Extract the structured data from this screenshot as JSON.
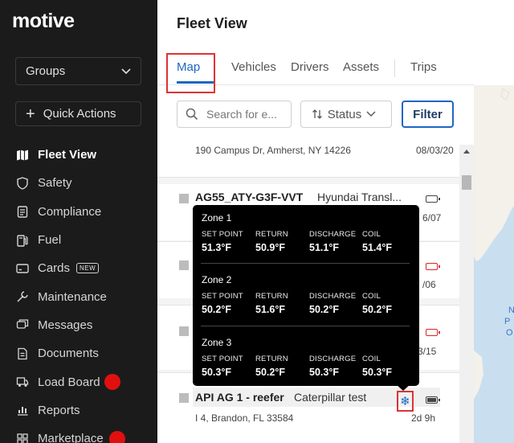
{
  "sidebar": {
    "logo": "motive",
    "groups_label": "Groups",
    "quick_actions_label": "Quick Actions",
    "nav": [
      {
        "label": "Fleet View",
        "icon": "map-icon",
        "active": true
      },
      {
        "label": "Safety",
        "icon": "shield-icon"
      },
      {
        "label": "Compliance",
        "icon": "clipboard-icon"
      },
      {
        "label": "Fuel",
        "icon": "fuel-pump-icon"
      },
      {
        "label": "Cards",
        "icon": "card-icon",
        "badge": "NEW"
      },
      {
        "label": "Maintenance",
        "icon": "wrench-icon"
      },
      {
        "label": "Messages",
        "icon": "chat-icon"
      },
      {
        "label": "Documents",
        "icon": "document-icon"
      },
      {
        "label": "Load Board",
        "icon": "truck-icon",
        "dot": true
      },
      {
        "label": "Reports",
        "icon": "chart-icon"
      },
      {
        "label": "Marketplace",
        "icon": "grid-icon",
        "dot": true
      }
    ]
  },
  "header": {
    "title": "Fleet View",
    "tabs": [
      "Map",
      "Vehicles",
      "Drivers",
      "Assets",
      "Trips"
    ],
    "active_tab": "Map"
  },
  "toolbar": {
    "search_placeholder": "Search for e...",
    "status_label": "Status",
    "filter_label": "Filter"
  },
  "list": {
    "row0": {
      "address": "190 Campus Dr, Amherst, NY 14226",
      "time": "08/03/20"
    },
    "row1": {
      "name": "AG55_ATY-G3F-VVT",
      "model": "Hyundai Transl...",
      "time": "6/07"
    },
    "row2": {
      "time": "/06"
    },
    "row3": {
      "time": "3/15"
    },
    "row4": {
      "name": "API AG 1 - reefer",
      "model": "Caterpillar test",
      "address": "I 4, Brandon, FL 33584",
      "time": "2d 9h"
    }
  },
  "tooltip": {
    "headers": [
      "SET POINT",
      "RETURN",
      "DISCHARGE",
      "COIL"
    ],
    "zones": [
      {
        "title": "Zone 1",
        "values": [
          "51.3°F",
          "50.9°F",
          "51.1°F",
          "51.4°F"
        ]
      },
      {
        "title": "Zone 2",
        "values": [
          "50.2°F",
          "51.6°F",
          "50.2°F",
          "50.2°F"
        ]
      },
      {
        "title": "Zone 3",
        "values": [
          "50.3°F",
          "50.2°F",
          "50.3°F",
          "50.3°F"
        ]
      }
    ]
  },
  "map": {
    "labels": [
      "N",
      "P",
      "O"
    ]
  },
  "colors": {
    "accent": "#1f66c4",
    "highlight": "#dd3333",
    "alert": "#e01010",
    "sidebar_bg": "#1b1b1b"
  }
}
